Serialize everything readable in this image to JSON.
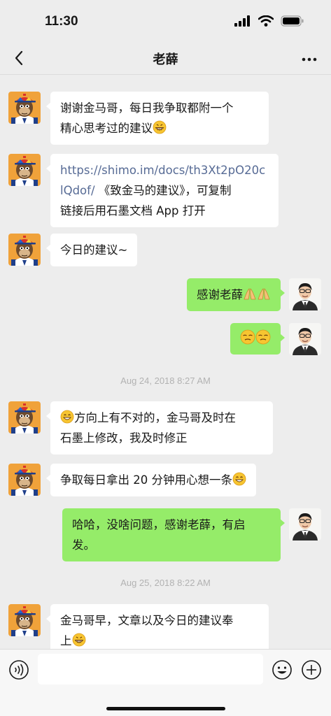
{
  "status_bar": {
    "time": "11:30"
  },
  "nav": {
    "title": "老薛"
  },
  "messages": [
    {
      "lines": [
        "谢谢金马哥，每日我争取都附一个",
        "精心思考过的建议"
      ]
    },
    {
      "link_lines": [
        "https://shimo.im/docs/th3Xt2pO20c",
        "lQdof/"
      ],
      "tail_first": " 《致金马的建议》，可复制",
      "tail_second": "链接后用石墨文档 App 打开"
    },
    {
      "text": "今日的建议~"
    },
    {
      "text": "感谢老薛"
    },
    {
      "text": ""
    },
    {
      "lines": [
        "方向上有不对的，金马哥及时在",
        "石墨上修改，我及时修正"
      ]
    },
    {
      "text": "争取每日拿出 20 分钟用心想一条"
    },
    {
      "lines": [
        "哈哈，没啥问题，感谢老薛，有启",
        "发。"
      ]
    },
    {
      "lines": [
        "金马哥早，文章以及今日的建议奉",
        "上"
      ]
    }
  ],
  "timestamps": [
    "Aug 24, 2018 8:27 AM",
    "Aug 25, 2018 8:22 AM"
  ],
  "icons": {
    "back": "chevron-left-icon",
    "more": "more-dots-icon",
    "voice": "voice-icon",
    "emoji": "emoji-icon",
    "plus": "plus-icon"
  },
  "colors": {
    "background": "#ededed",
    "bubble_self": "#95ec69",
    "bubble_other": "#ffffff",
    "link": "#576b95",
    "timestamp": "#b2b2b2"
  }
}
